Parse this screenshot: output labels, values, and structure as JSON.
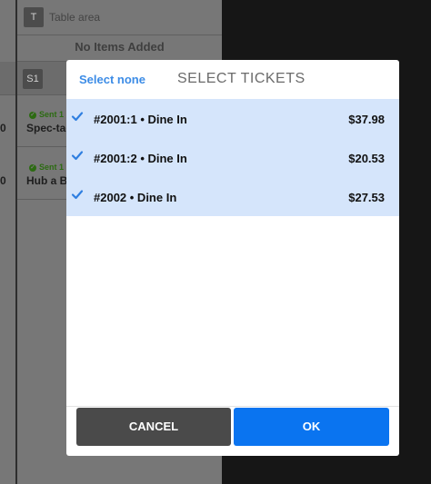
{
  "background": {
    "table_chip": "T",
    "table_area_label": "Table area",
    "no_items": "No Items Added",
    "seat_chip": "S1",
    "items": [
      {
        "sent": "Sent 1",
        "name": "Spec-tac",
        "left_num": "0"
      },
      {
        "sent": "Sent 1",
        "name": "Hub a B",
        "left_num": "0"
      }
    ]
  },
  "modal": {
    "select_none_label": "Select none",
    "title": "SELECT TICKETS",
    "tickets": [
      {
        "label": "#2001:1 • Dine In",
        "amount": "$37.98",
        "checked": true
      },
      {
        "label": "#2001:2 • Dine In",
        "amount": "$20.53",
        "checked": true
      },
      {
        "label": "#2002 • Dine In",
        "amount": "$27.53",
        "checked": true
      }
    ],
    "cancel_label": "CANCEL",
    "ok_label": "OK"
  },
  "colors": {
    "accent": "#0a74f0",
    "selected_row": "#d5e5fb",
    "check": "#2f7fe0",
    "cancel": "#4a4a4a"
  },
  "icons": {
    "check": "check-icon",
    "sent": "sent-check-icon"
  }
}
